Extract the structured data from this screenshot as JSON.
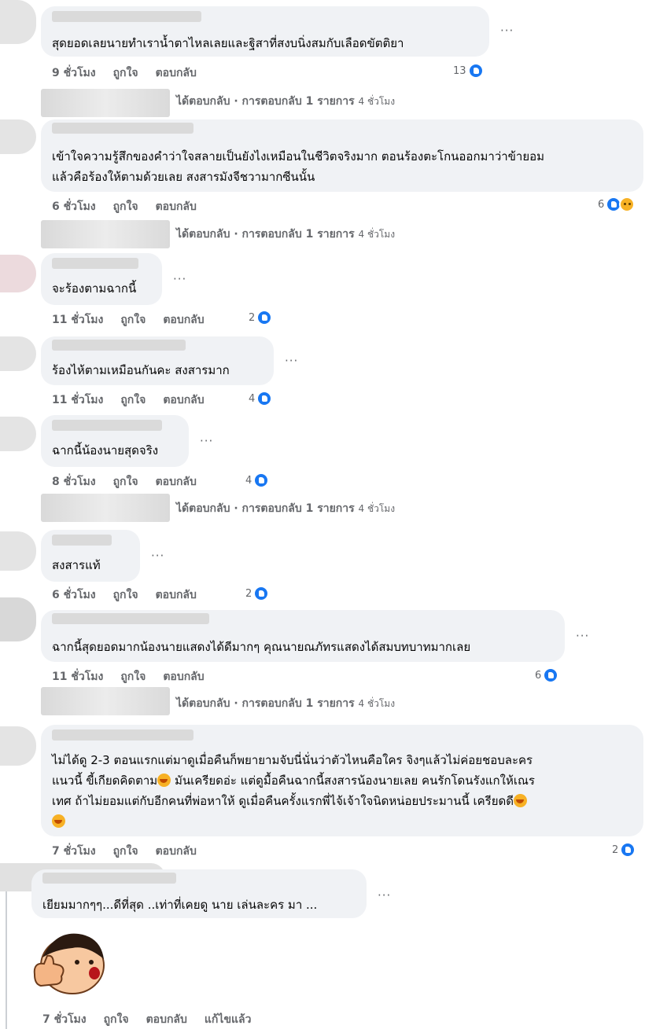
{
  "comments": [
    {
      "text": "สุดยอดเลยนายทำเราน้ำตาไหลเลยและฐิสาที่สงบนิ่งสมกับเลือดขัตติยา",
      "time": "9 ชั่วโมง",
      "count": "13"
    },
    {
      "text": "เข้าใจความรู้สึกของคำว่าใจสลายเป็นยังไงเหมือนในชีวิตจริงมาก ตอนร้องตะโกนออกมาว่าข้ายอม",
      "text2": "แล้วคือร้องให้ตามด้วยเลย สงสารมังจีชวามากซีนนั้น",
      "time": "6 ชั่วโมง",
      "count": "6"
    },
    {
      "text": "จะร้องตามฉากนี้",
      "time": "11 ชั่วโมง",
      "count": "2"
    },
    {
      "text": "ร้องไห้ตามเหมือนกันคะ สงสารมาก",
      "time": "11 ชั่วโมง",
      "count": "4"
    },
    {
      "text": "ฉากนี้น้องนายสุดจริง",
      "time": "8 ชั่วโมง",
      "count": "4"
    },
    {
      "text": "สงสารแท้",
      "time": "6 ชั่วโมง",
      "count": "2"
    },
    {
      "text": "ฉากนี้สุดยอดมากน้องนายแสดงได้ดีมากๆ คุณนายณภัทรแสดงได้สมบทบาทมากเลย",
      "time": "11 ชั่วโมง",
      "count": "6"
    },
    {
      "line1": "ไม่ได้ดู 2-3 ตอนแรกแต่มาดูเมื่อคืนก็พยายามจับนี่นั่นว่าตัวไหนคือใคร จิงๆแล้วไม่ค่อยชอบละคร",
      "line2a": "แนวนี้ ขี้เกียดคิดตาม",
      "line2b": " มันเครียดอ่ะ แต่ดูมื้อคืนฉากนี้สงสารน้องนายเลย คนรักโดนรังแกให้เณร",
      "line3a": "เทศ ถ้าไม่ยอมแต่กับอีกคนที่พ่อหาให้ ดูเมื่อคืนครั้งแรกพี่ไจ้เจ้าใจนิดหน่อยประมานนี้ เครียดดี",
      "time": "7 ชั่วโมง",
      "count": "2"
    },
    {
      "text": "เยียมมากๆๆ...ดีที่สุด ..เท่าที่เคยดู นาย เล่นละคร มา ...",
      "time": "7 ชั่วโมง",
      "edited": "แก้ไขแล้ว"
    }
  ],
  "labels": {
    "like": "ถูกใจ",
    "reply": "ตอบกลับ",
    "more": "···"
  },
  "reply_summary": {
    "label": "ได้ตอบกลับ · การตอบกลับ 1 รายการ",
    "time": "4 ชั่วโมง"
  }
}
